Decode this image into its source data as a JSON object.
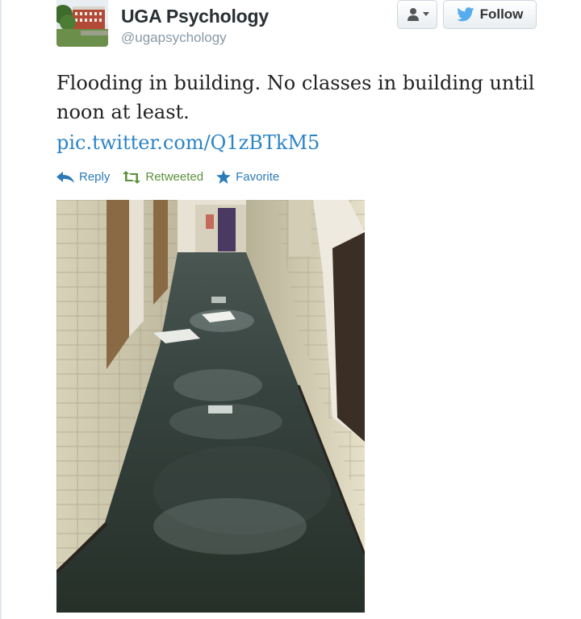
{
  "profile": {
    "name": "UGA Psychology",
    "handle": "@ugapsychology"
  },
  "buttons": {
    "follow_label": "Follow",
    "user_menu_icon": "user-chevron-icon",
    "follow_icon": "twitter-bird-icon"
  },
  "tweet": {
    "text": "Flooding in building. No classes in building until noon at least.",
    "link": "pic.twitter.com/Q1zBTkM5"
  },
  "actions": {
    "reply": "Reply",
    "retweeted": "Retweeted",
    "favorite": "Favorite"
  },
  "colors": {
    "link": "#2c84c6",
    "retweeted": "#5c913b",
    "action": "#2b7bb9",
    "follow_bird": "#55acee"
  }
}
